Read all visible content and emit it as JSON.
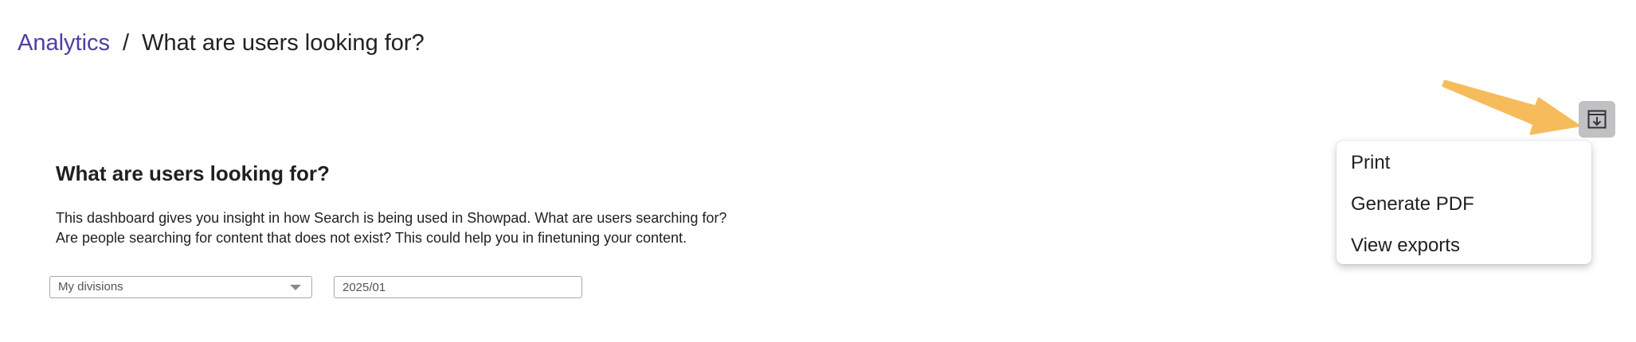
{
  "breadcrumb": {
    "parent": "Analytics",
    "separator": "/",
    "current": "What are users looking for?"
  },
  "dashboard": {
    "title": "What are users looking for?",
    "description_line1": "This dashboard gives you insight in how Search is being used in Showpad. What are users searching for?",
    "description_line2": "Are people searching for content that does not exist? This could help you in finetuning your content."
  },
  "filters": {
    "division_select": {
      "value": "My divisions"
    },
    "date_input": {
      "value": "2025/01"
    }
  },
  "export_menu": {
    "button_icon": "download-icon",
    "items": [
      {
        "label": "Print"
      },
      {
        "label": "Generate PDF"
      },
      {
        "label": "View exports"
      }
    ]
  },
  "colors": {
    "link": "#4b3fa6",
    "arrow": "#f6bc5b",
    "export_button_bg": "#c1c1c4",
    "text": "#1f1f24"
  }
}
